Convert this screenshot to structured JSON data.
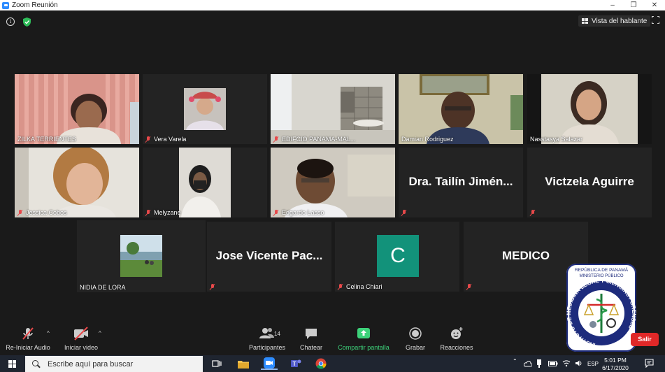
{
  "window": {
    "title": "Zoom Reunión",
    "minimize": "–",
    "restore": "❐",
    "close": "✕"
  },
  "topbar": {
    "info_glyph": "i",
    "speaker_view_label": "Vista del hablante"
  },
  "participants": [
    {
      "name": "ZILKA TERRIENTES",
      "muted": false,
      "video": true
    },
    {
      "name": "Vera Varela",
      "muted": true,
      "video": true
    },
    {
      "name": "EDIFCIO PANAMA-MAL...",
      "muted": true,
      "video": true
    },
    {
      "name": "Damian Rodriguez",
      "muted": false,
      "video": true
    },
    {
      "name": "Nasstasya Salazar",
      "muted": false,
      "video": true
    },
    {
      "name": "Jessica Cobos",
      "muted": true,
      "video": true
    },
    {
      "name": "Melyzane",
      "muted": true,
      "video": true
    },
    {
      "name": "Edgardo Lasso",
      "muted": true,
      "video": true
    },
    {
      "name": "Dra. Tailín Jiménez",
      "display": "Dra. Tailín Jimén...",
      "muted": true,
      "video": false
    },
    {
      "name": "Victzela Aguirre",
      "display": "Victzela Aguirre",
      "muted": true,
      "video": false
    },
    {
      "name": "NIDIA DE LORA",
      "muted": false,
      "video": true,
      "active_speaker": true
    },
    {
      "name": "Jose Vicente Pacheco",
      "display": "Jose Vicente Pac...",
      "muted": true,
      "video": false
    },
    {
      "name": "Celina Chiari",
      "avatar_letter": "C",
      "avatar_color": "#12927a",
      "muted": true,
      "video": false
    },
    {
      "name": "MEDICO",
      "display": "MEDICO",
      "muted": true,
      "video": false
    }
  ],
  "toolbar": {
    "audio_label": "Re-Iniciar Audio",
    "video_label": "Iniciar video",
    "participants_label": "Participantes",
    "participants_count": "14",
    "chat_label": "Chatear",
    "share_label": "Compartir pantalla",
    "record_label": "Grabar",
    "reactions_label": "Reacciones",
    "leave_label": "Salir",
    "caret": "^"
  },
  "logo": {
    "line1": "REPÚBLICA DE PANAMÁ",
    "line2": "MINISTERIO PÚBLICO",
    "ring": "INSTITUTO DE MEDICINA LEGAL Y CIENCIAS FORENSES"
  },
  "taskbar": {
    "search_placeholder": "Escribe aquí para buscar",
    "language": "ESP",
    "time": "5:01 PM",
    "date": "6/17/2020"
  },
  "colors": {
    "share_green": "#3dd27a",
    "leave_red": "#e02828",
    "active_outline": "#d9e84a"
  }
}
